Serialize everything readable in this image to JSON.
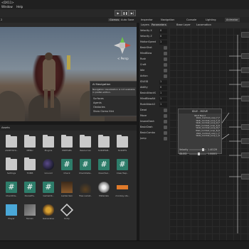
{
  "window": {
    "title": "<DX11>",
    "menus": [
      "Window",
      "Help"
    ]
  },
  "toolbar": {
    "play": "▶",
    "pause": "❚❚",
    "step": "▶|"
  },
  "scene_view": {
    "tab_label": "2",
    "buttons": {
      "gizmos": "Gizmos",
      "auto_save": "Auto Save"
    },
    "persp_label": "< Persp",
    "ai_nav": {
      "title": "AI Navigation",
      "message": "Navigation visualization is not available in prefab edition.",
      "items": [
        "Surfaces",
        "Agents",
        "Obstacles",
        "Show Gizmo Hint"
      ]
    }
  },
  "project": {
    "tab_label": "Assets",
    "row1": [
      {
        "label": "ASSETSTO..",
        "icon": "folder-icon"
      },
      {
        "label": "MENU",
        "icon": "folder-icon"
      },
      {
        "label": "Plugins",
        "icon": "folder-icon"
      },
      {
        "label": "PREFABS",
        "icon": "folder-icon"
      },
      {
        "label": "Resources",
        "icon": "folder-icon"
      },
      {
        "label": "SCRIPTAB..",
        "icon": "folder-icon"
      },
      {
        "label": "SCRIPTS",
        "icon": "folder-icon"
      }
    ],
    "row2": [
      {
        "label": "Settings",
        "icon": "folder-icon"
      },
      {
        "label": "TOMB",
        "icon": "folder-icon"
      },
      {
        "label": "Ground",
        "icon": "sphere-icon"
      },
      {
        "label": "Check",
        "icon": "script-icon"
      },
      {
        "label": "CheckDeta..",
        "icon": "script-icon"
      },
      {
        "label": "Clear/Sel..",
        "icon": "script-icon"
      },
      {
        "label": "Clear/Sep..",
        "icon": "script-icon"
      }
    ],
    "row3": [
      {
        "label": "CheckDis..",
        "icon": "script-icon"
      },
      {
        "label": "DanielFa..",
        "icon": "script-icon"
      },
      {
        "label": "GameOb..",
        "icon": "script-icon"
      },
      {
        "label": "Lanternlan",
        "icon": "lantern-icon"
      },
      {
        "label": "Tree variat..",
        "icon": "tree-icon"
      },
      {
        "label": "Materials",
        "icon": "materials-icon"
      },
      {
        "label": "monkey sta..",
        "icon": "audio-icon"
      }
    ],
    "row4": [
      {
        "label": "Player",
        "icon": "cube-icon"
      },
      {
        "label": "Terrain",
        "icon": "terrain-icon"
      },
      {
        "label": "Genevieve",
        "icon": "prefab-icon"
      },
      {
        "label": "Unity",
        "icon": "unity-icon"
      }
    ]
  },
  "tabs": {
    "inspector": "Inspector",
    "navigation": "Navigation",
    "console": "Console",
    "lighting": "Lighting",
    "animator": "Animator"
  },
  "animator": {
    "layers": "Layers",
    "parameters": "Parameters",
    "base_layer": "Base Layer",
    "locomotion": "Locomotion",
    "params": [
      {
        "name": "Velocity X",
        "value": "0",
        "type": "float"
      },
      {
        "name": "Velocity Z",
        "value": "0",
        "type": "float"
      },
      {
        "name": "MotionSpeed",
        "value": "1",
        "type": "float"
      },
      {
        "name": "BasicShot",
        "value": "",
        "type": "bool"
      },
      {
        "name": "MindBlow",
        "value": "",
        "type": "bool"
      },
      {
        "name": "Rush",
        "value": "",
        "type": "bool"
      },
      {
        "name": "Craft",
        "value": "",
        "type": "bool"
      },
      {
        "name": "Idle",
        "value": "",
        "type": "bool"
      },
      {
        "name": "Action",
        "value": "",
        "type": "bool"
      },
      {
        "name": "IDLEID",
        "value": "1",
        "type": "float"
      },
      {
        "name": "Ability",
        "value": "0",
        "type": "float"
      },
      {
        "name": "BasicAttackS",
        "value": "1",
        "type": "float"
      },
      {
        "name": "MindBlowAtt",
        "value": "1",
        "type": "float"
      },
      {
        "name": "RushAttack2",
        "value": "1",
        "type": "float"
      },
      {
        "name": "Dead",
        "value": "",
        "type": "bool"
      },
      {
        "name": "Move",
        "value": "",
        "type": "bool"
      },
      {
        "name": "InsaneDash",
        "value": "",
        "type": "bool"
      },
      {
        "name": "BasicDash",
        "value": "",
        "type": "bool"
      },
      {
        "name": "BasicCombo",
        "value": "",
        "type": "bool"
      },
      {
        "name": "Jump",
        "value": "",
        "type": "bool"
      }
    ],
    "state": {
      "title": "IDLE - MOVE",
      "blend": "IDLE Blend",
      "motions": [
        "Walk_Combat_Loop_F_F",
        "Walk_Combat_Loop_F_R",
        "Walk_Combat_Loop_R_F",
        "Walk_Combat_Loop_R_R",
        "Walk_Combat_Loop_B_F",
        "Walk_Combat_Loop_B_R",
        "Walk_Combat_Loop_L_F",
        "Walk_Combat_Loop_L_R"
      ],
      "velocity_label": "Velocity",
      "velocity_x": "1.40129",
      "idleid_label": "IDLEID",
      "idleid_value": "1.00001"
    }
  },
  "colors": {
    "accent_blue": "#3a6ea5",
    "script_green": "#2e7d6a",
    "folder_grey": "#c9c9c9"
  }
}
